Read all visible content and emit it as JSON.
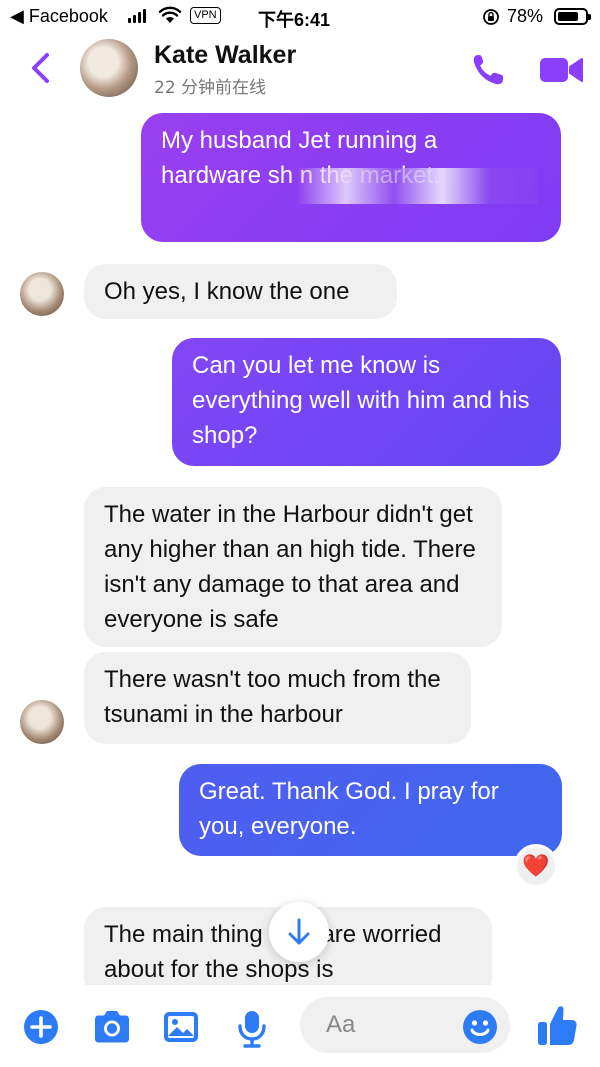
{
  "status_bar": {
    "back_app": "◀ Facebook",
    "vpn": "VPN",
    "time": "下午6:41",
    "battery": "78%",
    "battery_level": 0.78
  },
  "header": {
    "contact_name": "Kate Walker",
    "presence": "22 分钟前在线"
  },
  "messages": [
    {
      "side": "out",
      "text": "My husband Jet running a hardware sh                 n the market."
    },
    {
      "side": "in",
      "text": "Oh yes, I know the one"
    },
    {
      "side": "out",
      "text": "Can you let me know is everything well with him and his shop?"
    },
    {
      "side": "in",
      "text": "The water in the Harbour didn't get any higher than an high tide. There isn't any damage to that area and everyone is safe"
    },
    {
      "side": "in",
      "text": "There wasn't too much from the tsunami in the harbour"
    },
    {
      "side": "out",
      "text": "Great. Thank God. I pray for you, everyone.",
      "reaction": "❤️"
    },
    {
      "side": "in",
      "text": "The main thing they are worried about for the shops is"
    }
  ],
  "composer": {
    "placeholder": "Aa"
  },
  "colors": {
    "accent": "#8a3ffc",
    "bubble_in": "#f0f0f0",
    "icon_blue": "#2d7cf6"
  }
}
